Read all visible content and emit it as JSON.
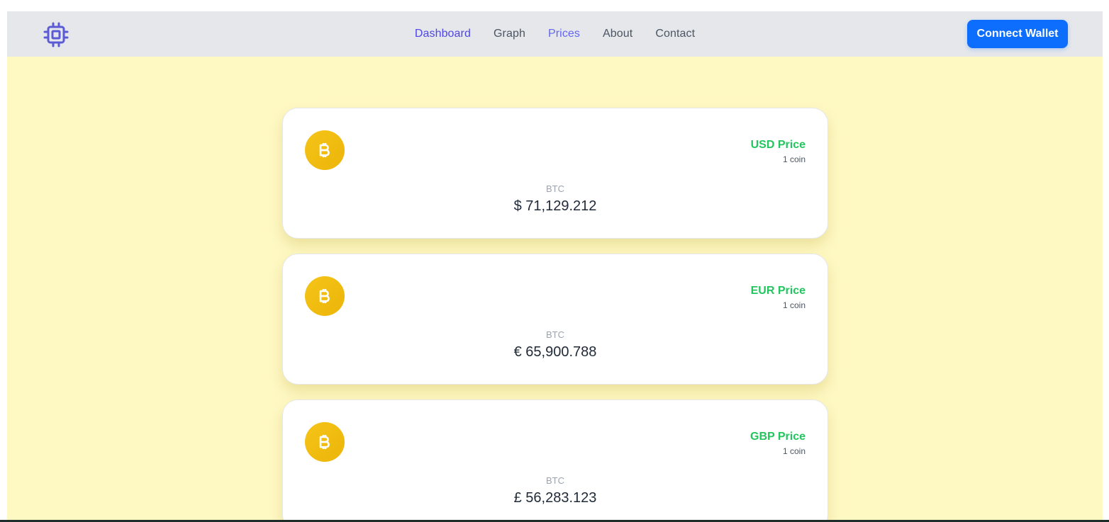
{
  "navbar": {
    "logo_icon": "cpu-chip-icon",
    "links": [
      {
        "label": "Dashboard",
        "state": "active"
      },
      {
        "label": "Graph",
        "state": "normal"
      },
      {
        "label": "Prices",
        "state": "hover"
      },
      {
        "label": "About",
        "state": "normal"
      },
      {
        "label": "Contact",
        "state": "normal"
      }
    ],
    "connect_button": "Connect Wallet"
  },
  "cards": [
    {
      "icon": "bitcoin-icon",
      "price_label": "USD Price",
      "unit": "1 coin",
      "ticker": "BTC",
      "value": "$ 71,129.212"
    },
    {
      "icon": "bitcoin-icon",
      "price_label": "EUR Price",
      "unit": "1 coin",
      "ticker": "BTC",
      "value": "€ 65,900.788"
    },
    {
      "icon": "bitcoin-icon",
      "price_label": "GBP Price",
      "unit": "1 coin",
      "ticker": "BTC",
      "value": "£ 56,283.123"
    }
  ],
  "colors": {
    "page_background": "#fef8c3",
    "navbar_background": "#e5e7eb",
    "active_link": "#4f46e5",
    "button": "#0d6efd",
    "price_label": "#22c55e",
    "coin": "#f5c518"
  }
}
